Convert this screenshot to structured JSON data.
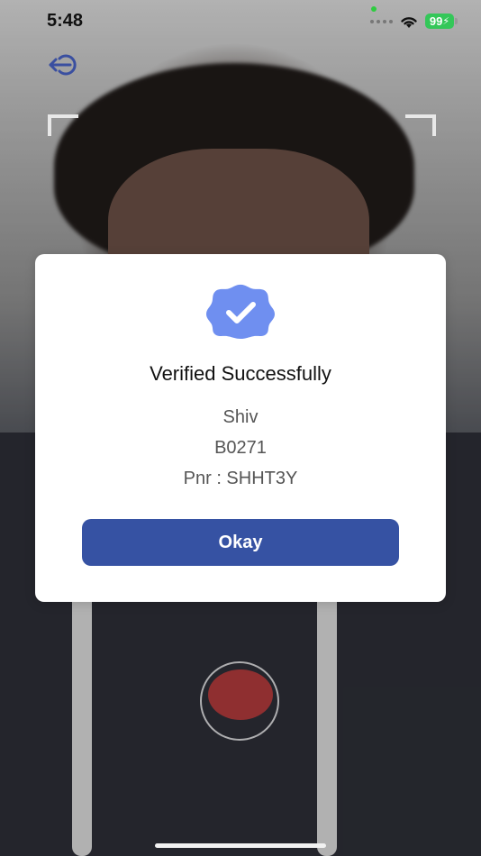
{
  "status_bar": {
    "time": "5:48",
    "battery": "99"
  },
  "icons": {
    "back": "logout-arrow-icon",
    "wifi": "wifi-icon",
    "badge": "verified-badge-icon"
  },
  "modal": {
    "title": "Verified Successfully",
    "name": "Shiv",
    "id": "B0271",
    "pnr": "Pnr : SHHT3Y",
    "button_label": "Okay"
  },
  "colors": {
    "accent": "#3652a3",
    "badge": "#6f8ff0",
    "record": "#8f2f30",
    "battery": "#34c759"
  }
}
